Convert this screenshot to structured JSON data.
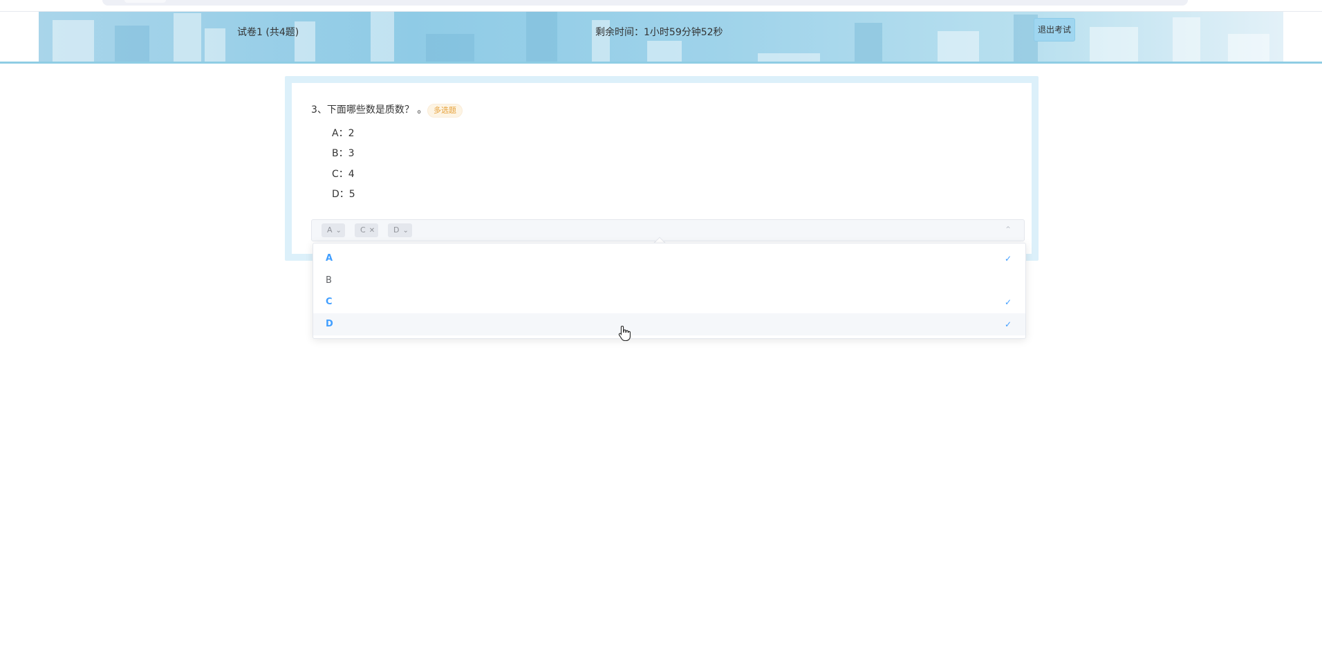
{
  "header": {
    "exam_title": "试卷1 (共4题)",
    "timer_text": "剩余时间：1小时59分钟52秒",
    "exit_label": "退出考试"
  },
  "question": {
    "text": "3、下面哪些数是质数？ 。",
    "tag": "多选题",
    "options": [
      {
        "label": "A：2"
      },
      {
        "label": "B：3"
      },
      {
        "label": "C：4"
      },
      {
        "label": "D：5"
      }
    ]
  },
  "select": {
    "chips": [
      {
        "label": "A",
        "icon": "chevron-down-icon"
      },
      {
        "label": "C",
        "icon": "close-icon"
      },
      {
        "label": "D",
        "icon": "chevron-down-icon"
      }
    ],
    "arrow_icon": "chevron-up-icon"
  },
  "dropdown": {
    "items": [
      {
        "label": "A",
        "selected": true
      },
      {
        "label": "B",
        "selected": false
      },
      {
        "label": "C",
        "selected": true
      },
      {
        "label": "D",
        "selected": true,
        "hovered": true
      }
    ]
  },
  "colors": {
    "accent": "#409eff",
    "tag_text": "#e6a23c",
    "banner": "#8fcbe6"
  }
}
